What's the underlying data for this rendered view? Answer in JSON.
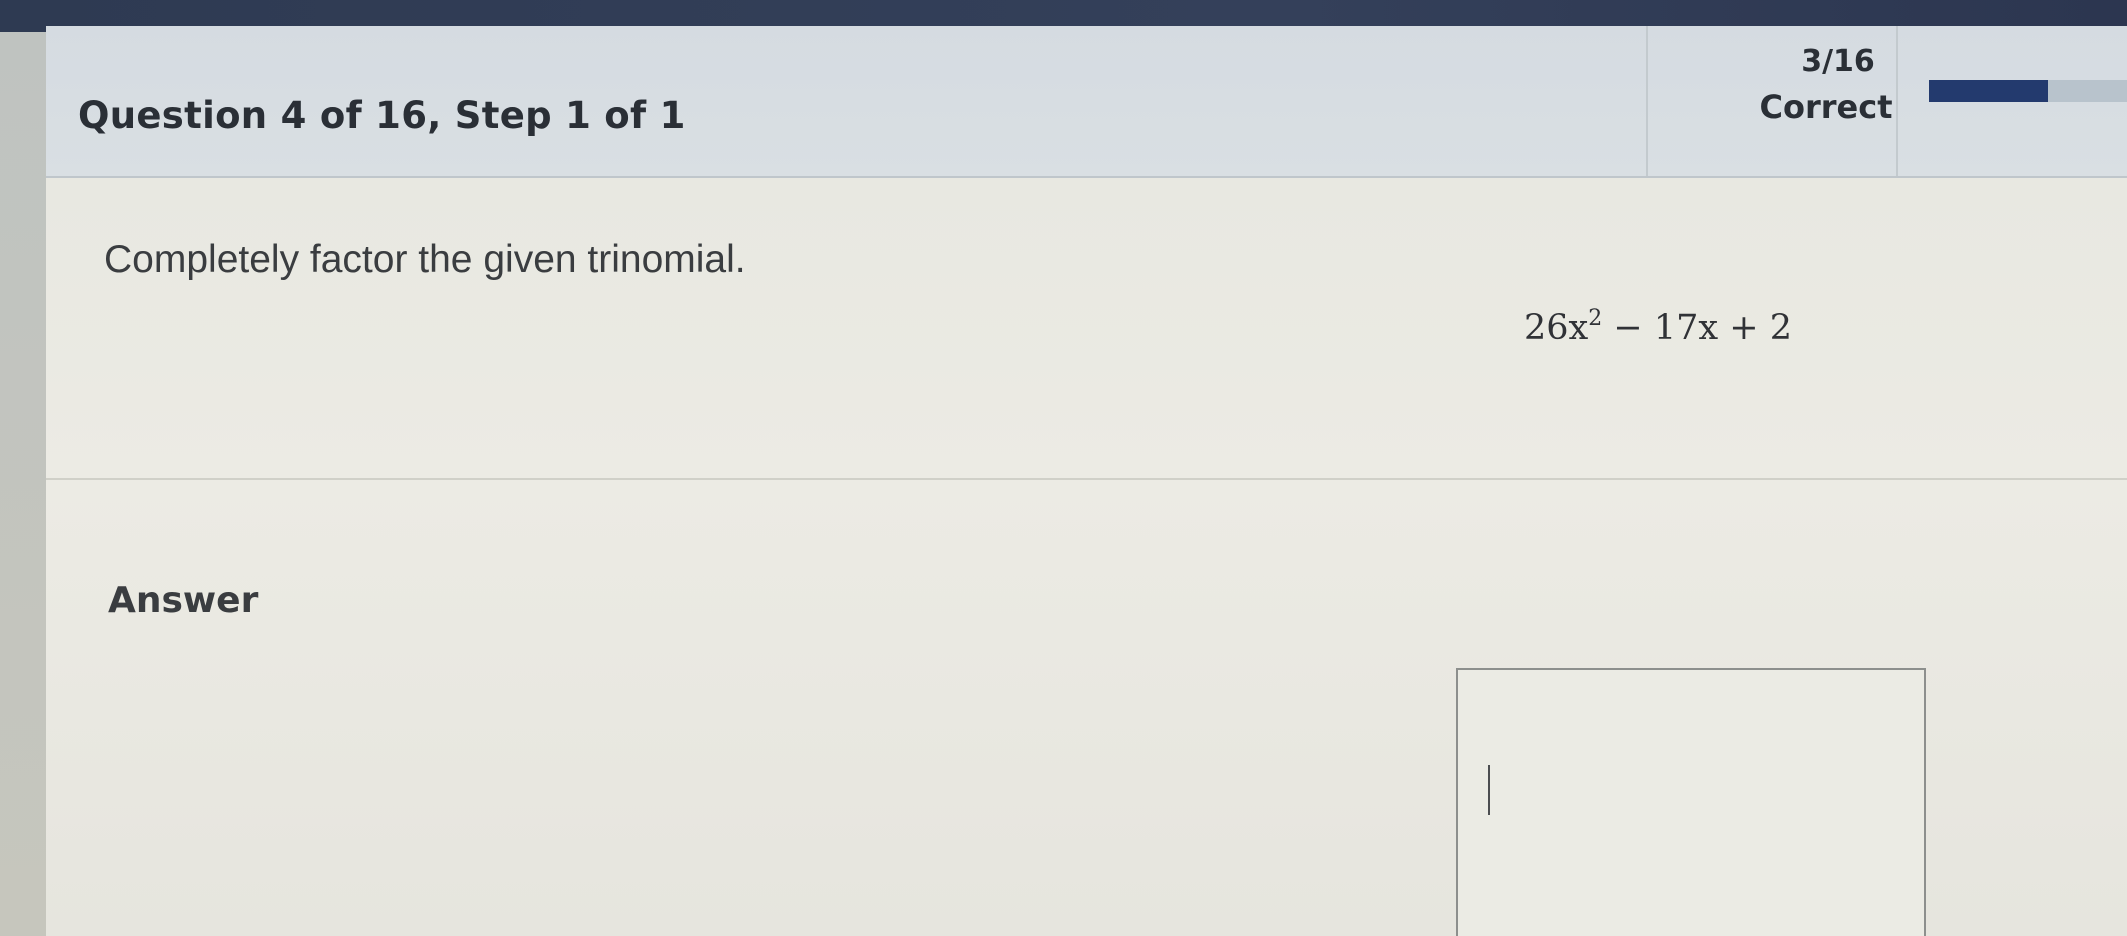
{
  "header": {
    "question_title": "Question 4 of 16,  Step 1 of 1",
    "score": "3/16",
    "status": "Correct",
    "progress_fraction": 0.6
  },
  "question": {
    "prompt": "Completely factor the given trinomial.",
    "expression_lead": "26x",
    "expression_exponent": "2",
    "expression_tail": " − 17x + 2"
  },
  "answer": {
    "label": "Answer",
    "value": ""
  },
  "colors": {
    "header_bg": "#d7dde2",
    "content_bg": "#eaeae3",
    "progress_fill": "#233a6e",
    "progress_track": "#b8c3cc",
    "text": "#2a2f36"
  }
}
